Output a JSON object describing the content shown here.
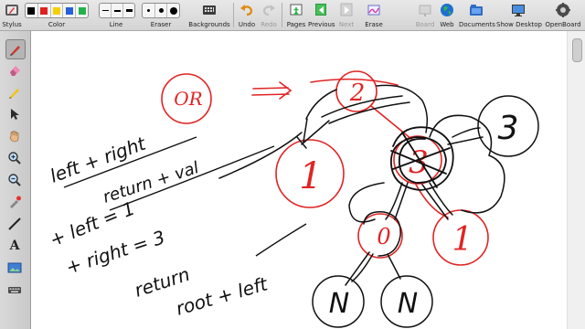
{
  "toolbar": {
    "stylus": "Stylus",
    "color": "Color",
    "line": "Line",
    "eraser": "Eraser",
    "backgrounds": "Backgrounds",
    "undo": "Undo",
    "redo": "Redo",
    "pages": "Pages",
    "previous": "Previous",
    "next": "Next",
    "erase": "Erase",
    "board": "Board",
    "web": "Web",
    "documents": "Documents",
    "show_desktop": "Show Desktop",
    "openboard": "OpenBoard"
  },
  "colors": {
    "palette": [
      "#000000",
      "#e02020",
      "#f5d000",
      "#2860d8",
      "#22b24a"
    ],
    "ink_red": "#e02424",
    "ink_black": "#111111"
  },
  "sidebar": {
    "text_tool_glyph": "A"
  },
  "board": {
    "red_circle_label_or": "OR",
    "node_root": "2",
    "node_left": "1",
    "node_right": "3",
    "node_right_left": "0",
    "node_right_right": "1",
    "node_null_a": "N",
    "node_null_b": "N",
    "node_far_right": "3",
    "text_left_right": "left + right",
    "text_return_val": "return + val",
    "text_left_eq": "+ left = 1",
    "text_right_eq": "+ right = 3",
    "text_return": "return",
    "text_root_val": "root + left"
  }
}
